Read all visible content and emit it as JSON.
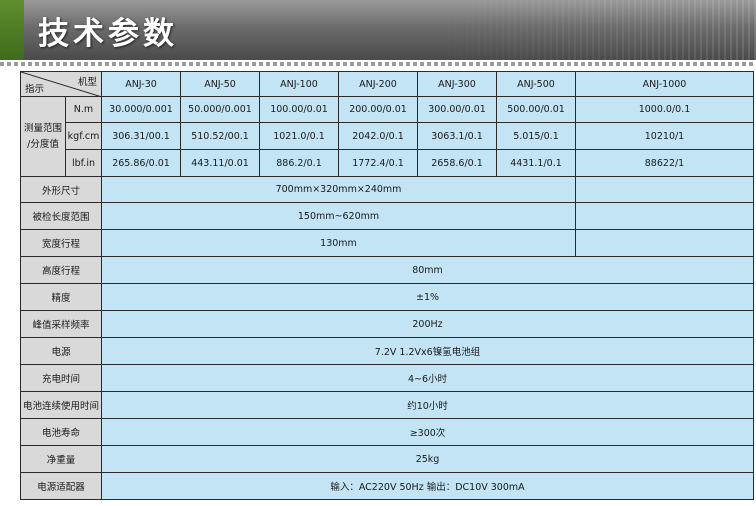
{
  "header": {
    "title": "技术参数"
  },
  "table": {
    "corner_top": "机型",
    "corner_bottom": "指示",
    "models": [
      "ANJ-30",
      "ANJ-50",
      "ANJ-100",
      "ANJ-200",
      "ANJ-300",
      "ANJ-500",
      "ANJ-1000"
    ],
    "range_label_line1": "测量范围",
    "range_label_line2": "/分度值",
    "range_rows": [
      {
        "unit": "N.m",
        "values": [
          "30.000/0.001",
          "50.000/0.001",
          "100.00/0.01",
          "200.00/0.01",
          "300.00/0.01",
          "500.00/0.01",
          "1000.0/0.1"
        ]
      },
      {
        "unit": "kgf.cm",
        "values": [
          "306.31/00.1",
          "510.52/00.1",
          "1021.0/0.1",
          "2042.0/0.1",
          "3063.1/0.1",
          "5.015/0.1",
          "10210/1"
        ]
      },
      {
        "unit": "lbf.in",
        "values": [
          "265.86/0.01",
          "443.11/0.01",
          "886.2/0.1",
          "1772.4/0.1",
          "2658.6/0.1",
          "4431.1/0.1",
          "88622/1"
        ]
      }
    ],
    "size": {
      "label": "外形尺寸",
      "value": "700mm×320mm×240mm",
      "value_1000": ""
    },
    "length_range": {
      "label": "被检长度范围",
      "value": "150mm~620mm",
      "value_1000": ""
    },
    "width_travel": {
      "label": "宽度行程",
      "value": "130mm",
      "value_1000": ""
    },
    "rows": [
      {
        "label": "高度行程",
        "value": "80mm"
      },
      {
        "label": "精度",
        "value": "±1%"
      },
      {
        "label": "峰值采样频率",
        "value": "200Hz"
      },
      {
        "label": "电源",
        "value": "7.2V 1.2Vx6镍氢电池组"
      },
      {
        "label": "充电时间",
        "value": "4~6小时"
      },
      {
        "label": "电池连续使用时间",
        "value": "约10小时"
      },
      {
        "label": "电池寿命",
        "value": "≥300次"
      },
      {
        "label": "净重量",
        "value": "25kg"
      },
      {
        "label": "电源适配器",
        "value": "输入：AC220V 50Hz 输出：DC10V 300mA"
      }
    ]
  },
  "colors": {
    "label_bg": "#d9d9d9",
    "value_bg": "#c3e4f5",
    "banner": "#6c6c6c",
    "accent_green": "#5d8f2e"
  }
}
